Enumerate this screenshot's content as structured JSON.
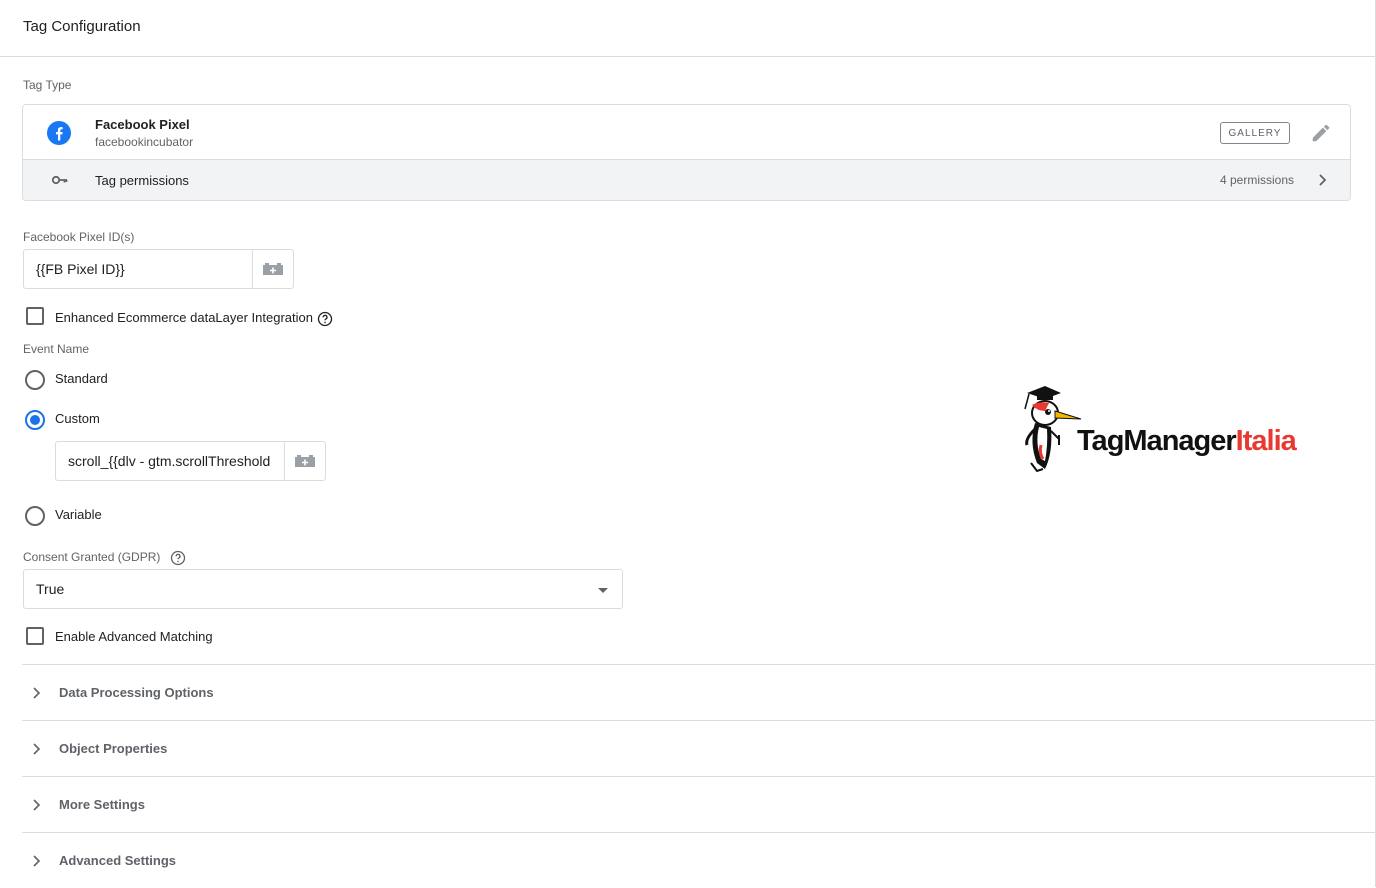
{
  "header": {
    "title": "Tag Configuration"
  },
  "tag_type": {
    "section_label": "Tag Type",
    "name": "Facebook Pixel",
    "vendor": "facebookincubator",
    "gallery_label": "GALLERY",
    "permissions_label": "Tag permissions",
    "permissions_count": "4 permissions",
    "icons": {
      "brand": "facebook-icon",
      "edit": "pencil-icon",
      "permissions": "key-icon",
      "open": "chevron-right-icon"
    }
  },
  "pixel_id": {
    "label": "Facebook Pixel ID(s)",
    "value": "{{FB Pixel ID}}"
  },
  "enhanced_ecommerce": {
    "label": "Enhanced Ecommerce dataLayer Integration",
    "checked": false
  },
  "event_name": {
    "label": "Event Name",
    "options": [
      {
        "label": "Standard",
        "selected": false
      },
      {
        "label": "Custom",
        "selected": true
      },
      {
        "label": "Variable",
        "selected": false
      }
    ],
    "custom_value": "scroll_{{dlv - gtm.scrollThreshold"
  },
  "consent": {
    "label": "Consent Granted (GDPR)",
    "value": "True"
  },
  "advanced_matching": {
    "label": "Enable Advanced Matching",
    "checked": false
  },
  "sections": [
    {
      "label": "Data Processing Options"
    },
    {
      "label": "Object Properties"
    },
    {
      "label": "More Settings"
    },
    {
      "label": "Advanced Settings"
    }
  ],
  "watermark": {
    "part1": "TagManager",
    "part2": "Italia"
  },
  "colors": {
    "accent": "#1a73e8",
    "facebook": "#1877f2",
    "watermark_red": "#e8382f"
  }
}
